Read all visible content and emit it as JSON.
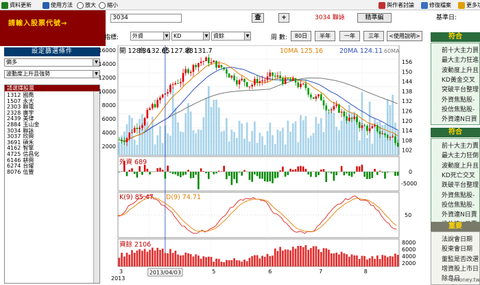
{
  "toolbar": {
    "items": [
      "資料更新",
      "使用方法",
      "放大",
      "縮小"
    ],
    "right_items": [
      "與作者討論",
      "修復檔案",
      "更多功能"
    ]
  },
  "left": {
    "title": "請輸入股票代號→",
    "filter_header": "設定篩選條件",
    "select1": "偏多",
    "select2": "波動度上升且強勢",
    "list_header": "請選擇股票",
    "stocks": [
      {
        "code": "1312",
        "name": "國喬"
      },
      {
        "code": "1507",
        "name": "永大"
      },
      {
        "code": "2303",
        "name": "聯電"
      },
      {
        "code": "2328",
        "name": "廣宇"
      },
      {
        "code": "2439",
        "name": "美律"
      },
      {
        "code": "2884",
        "name": "玉山金"
      },
      {
        "code": "3034",
        "name": "聯詠"
      },
      {
        "code": "3037",
        "name": "欣興"
      },
      {
        "code": "3691",
        "name": "碩禾"
      },
      {
        "code": "4162",
        "name": "智擎"
      },
      {
        "code": "4725",
        "name": "信昌化"
      },
      {
        "code": "6146",
        "name": "耕興"
      },
      {
        "code": "6274",
        "name": "台燿"
      },
      {
        "code": "8076",
        "name": "伍豐"
      }
    ]
  },
  "stockbar": {
    "code": "3034",
    "query": "查",
    "add": "+",
    "name": "3034 聯詠",
    "clean": "精準編",
    "base_date_label": "基準日:"
  },
  "indicators": {
    "label": "指標:",
    "sel1": "外資",
    "sel2": "KD",
    "sel3": "資餘",
    "days_label": "周 數:",
    "days_value": "80日",
    "half": "半年",
    "one": "一年",
    "three": "三年",
    "help": "<使用說明>"
  },
  "chart_data": {
    "type": "stock",
    "header": {
      "open": "開 128.36",
      "high": "高 132.65",
      "low": "低 127.88",
      "close": "收 131.7",
      "ma10": "10MA 125.16",
      "ma20": "20MA 124.11",
      "ma60": "60MA"
    },
    "vol_ticks": [
      "16000",
      "14000",
      "12000",
      "10000",
      "8000",
      "6000",
      "4000",
      "2000"
    ],
    "price_ticks": [
      "156",
      "150",
      "144",
      "138",
      "132",
      "126",
      "120",
      "114",
      "108",
      "102"
    ],
    "foreign_label": "外資 689",
    "foreign_ticks": [
      "0",
      "-5000"
    ],
    "kd_label_k": "K(9) 85.47",
    "kd_label_d": "D(9) 74.71",
    "kd_ticks": [
      "50"
    ],
    "margin_label": "資餘 2106",
    "margin_ticks": [
      "8000",
      "6000",
      "4000",
      "2000"
    ],
    "month_labels": [
      "3",
      "4",
      "5",
      "6",
      "7",
      "8"
    ],
    "year_label": "2013",
    "cursor_date": "2013/04/03",
    "price_range": [
      99,
      156
    ],
    "vol_range": [
      0,
      16000
    ],
    "kd_range": [
      0,
      100
    ],
    "margin_range": [
      0,
      8000
    ]
  },
  "right": {
    "header1": "符合",
    "box1": [
      "前十大主力買",
      "最大主力狂進",
      "波動度上升且",
      "KD黃金交叉",
      "突破平台整理",
      "外資焦點股-",
      "投信焦點股-",
      "外資連N日買"
    ],
    "header2": "符合",
    "box2": [
      "前十大主力賣",
      "最大主力狂倒",
      "波動度上升且",
      "KD死亡交叉",
      "跌破平台整理",
      "外資焦點股-",
      "投信焦點股-",
      "外資連N日賣",
      "投信連N日賣"
    ],
    "header3": "重要",
    "box3": [
      "法說會日期",
      "股東會日期",
      "董監是否改選",
      "增資股上市日",
      "除息日"
    ]
  },
  "credit": "cmoney.tw",
  "colors": {
    "accent": "#8a0000",
    "panel_green": "#2b6b3c",
    "candle_up": "#dd0000",
    "candle_down": "#009900",
    "vol": "#9ccde6"
  }
}
